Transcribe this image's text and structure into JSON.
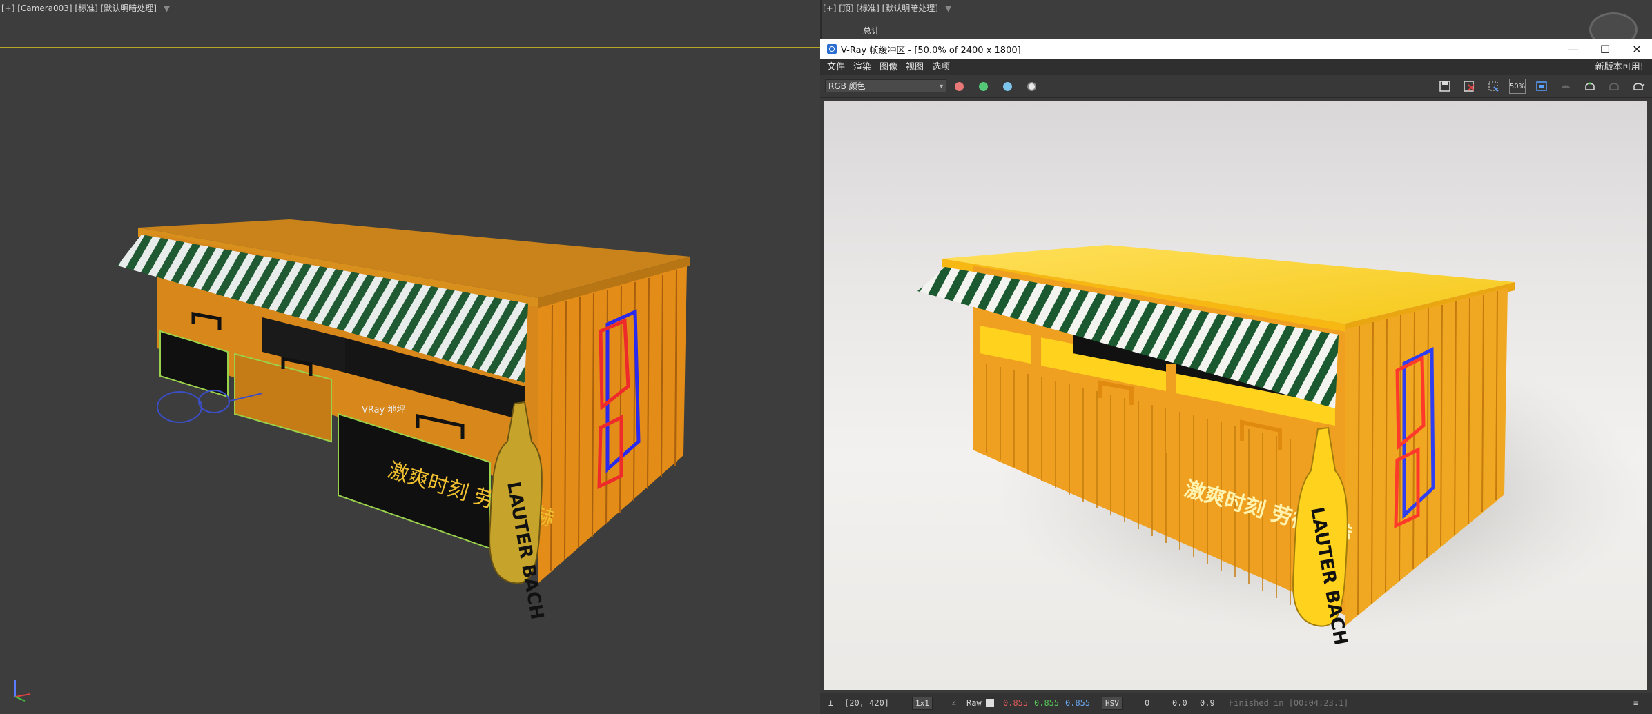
{
  "left_viewport": {
    "label": "[+] [Camera003] [标准] [默认明暗处理]",
    "menu_arrow": "▼",
    "object_label": "VRay 地坪"
  },
  "right_viewport": {
    "label": "[+] [顶] [标准] [默认明暗处理]",
    "menu_arrow": "▼",
    "stats_label": "总计"
  },
  "vfb": {
    "title": "V-Ray 帧缓冲区 - [50.0% of 2400 x 1800]",
    "window_buttons": {
      "minimize": "—",
      "maximize": "☐",
      "close": "✕"
    },
    "menu": [
      "文件",
      "渲染",
      "图像",
      "视图",
      "选项"
    ],
    "update_notice": "新版本可用!",
    "channel": "RGB 颜色",
    "channel_caret": "▾",
    "color_dots": {
      "red": "#e87777",
      "green": "#55c878",
      "blue": "#7cc4ea"
    },
    "toolbar_icons": [
      "save-icon",
      "clear-icon",
      "region-icon",
      "zoom-50-icon",
      "compare-icon",
      "track-icon",
      "teapot-icon",
      "teapot-disabled-icon",
      "teapot-render-icon"
    ],
    "zoom_badge": "50%",
    "status": {
      "coords": "[20, 420]",
      "ratio": "1x1",
      "raw": "Raw",
      "r": "0.855",
      "g": "0.855",
      "b": "0.855",
      "mode": "HSV",
      "v1": "0",
      "v2": "0.0",
      "v3": "0.9",
      "finished": "Finished in [00:04:23.1]"
    }
  },
  "render_art": {
    "slogan": "激爽时刻 劳德巴赫",
    "bottle_text": "LAUTER BACH"
  },
  "colors": {
    "viewport_bg": "#3d3d3d",
    "safe_frame": "#b5a62a",
    "booth_orange": "#e8961c",
    "booth_yellow": "#ffd21e",
    "awning_green": "#1f5a33"
  }
}
